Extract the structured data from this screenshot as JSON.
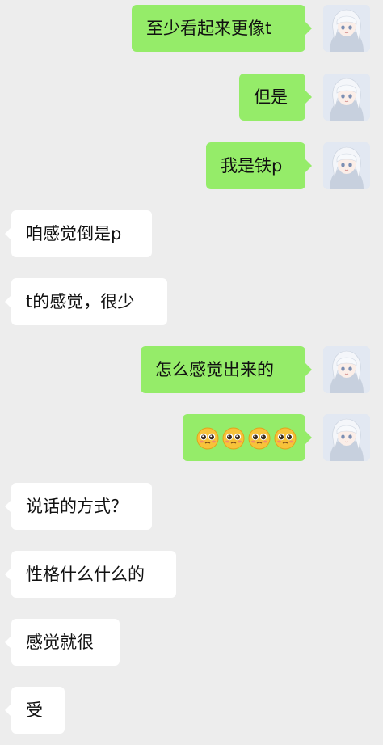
{
  "conversation": {
    "messages": [
      {
        "side": "out",
        "text": "至少看起来更像t"
      },
      {
        "side": "out",
        "text": "但是"
      },
      {
        "side": "out",
        "text": "我是铁p"
      },
      {
        "side": "in",
        "text": "咱感觉倒是p"
      },
      {
        "side": "in",
        "text": "t的感觉，很少"
      },
      {
        "side": "out",
        "text": "怎么感觉出来的"
      },
      {
        "side": "out",
        "emoji": [
          "pleading-face-icon",
          "pleading-face-icon",
          "pleading-face-icon",
          "pleading-face-icon"
        ]
      },
      {
        "side": "in",
        "text": "说话的方式？"
      },
      {
        "side": "in",
        "text": "性格什么什么的"
      },
      {
        "side": "in",
        "text": "感觉就很"
      },
      {
        "side": "in",
        "text": "受"
      }
    ]
  },
  "colors": {
    "background": "#ededed",
    "outgoing_bubble": "#95ec69",
    "incoming_bubble": "#ffffff",
    "text": "#111111"
  }
}
